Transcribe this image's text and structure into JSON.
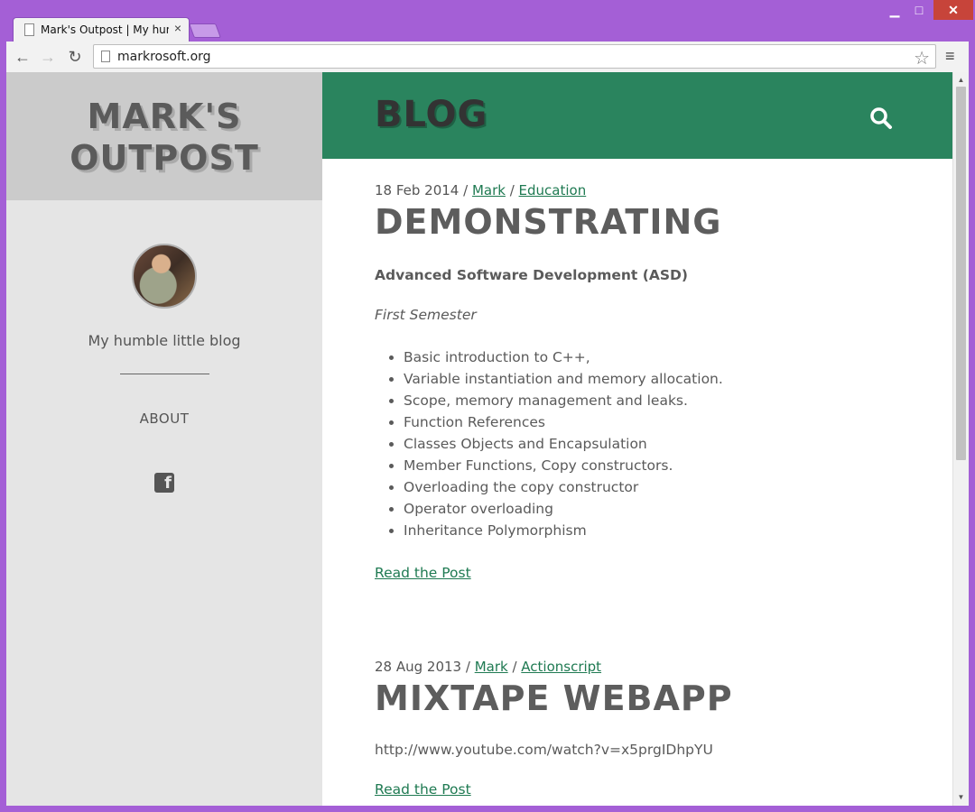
{
  "browser": {
    "tab_title": "Mark's Outpost | My humble little blog",
    "tab_close": "×",
    "url": "markrosoft.org",
    "nav": {
      "back": "←",
      "forward": "→",
      "reload": "↻"
    },
    "star": "☆",
    "menu": "≡",
    "window": {
      "minimize": "▁",
      "maximize": "□",
      "close": "✕"
    }
  },
  "sidebar": {
    "site_title_line1": "MARK'S",
    "site_title_line2": "OUTPOST",
    "tagline": "My humble little blog",
    "about_label": "ABOUT",
    "facebook_letter": "f"
  },
  "main": {
    "header_title": "BLOG",
    "posts": [
      {
        "date": "18 Feb 2014",
        "sep": " / ",
        "author": "Mark",
        "category": "Education",
        "title": "DEMONSTRATING",
        "subtitle_bold": "Advanced Software Development (ASD)",
        "subtitle_italic": "First Semester",
        "items": [
          "Basic introduction to C++,",
          "Variable instantiation and memory allocation.",
          "Scope, memory management and leaks.",
          "Function References",
          "Classes Objects and Encapsulation",
          "Member Functions, Copy constructors.",
          "Overloading the copy constructor",
          "Operator overloading",
          "Inheritance Polymorphism"
        ],
        "read_more": "Read the Post"
      },
      {
        "date": "28 Aug 2013",
        "sep": " / ",
        "author": "Mark",
        "category": "Actionscript",
        "title": "MIXTAPE WEBAPP",
        "body": "http://www.youtube.com/watch?v=x5prgIDhpYU",
        "read_more": "Read the Post"
      }
    ]
  },
  "scrollbar": {
    "up": "▲",
    "down": "▼",
    "position": 0.0
  },
  "colors": {
    "frame": "#a45fd6",
    "accent_green": "#2a845e",
    "link_green": "#1f7a52",
    "sidebar": "#e5e5e5"
  }
}
